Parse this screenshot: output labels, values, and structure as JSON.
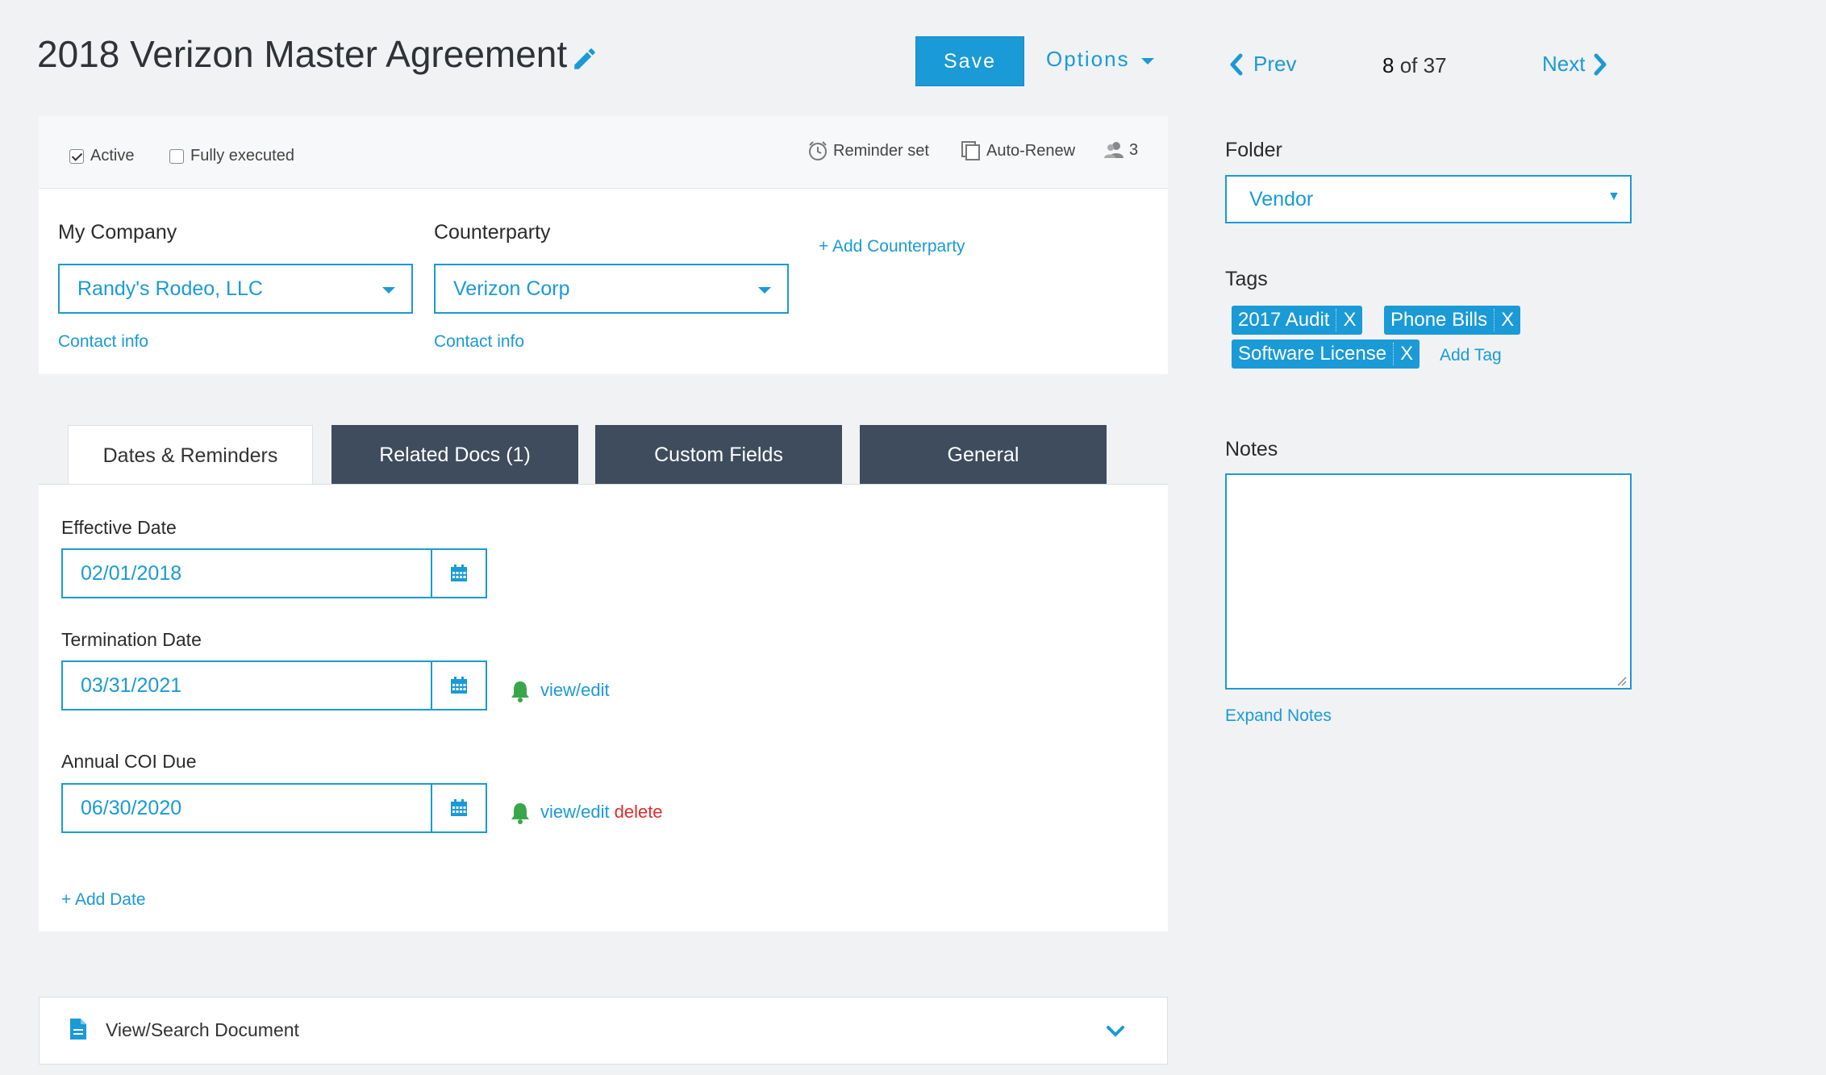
{
  "header": {
    "title": "2018 Verizon Master Agreement",
    "save_label": "Save",
    "options_label": "Options",
    "prev_label": "Prev",
    "page_current": "8",
    "page_of": "of 37",
    "next_label": "Next"
  },
  "status": {
    "active_label": "Active",
    "active_checked": true,
    "fully_executed_label": "Fully executed",
    "fully_executed_checked": false,
    "reminder_label": "Reminder set",
    "auto_renew_label": "Auto-Renew",
    "users_count": "3"
  },
  "parties": {
    "my_company_label": "My Company",
    "my_company_value": "Randy's Rodeo, LLC",
    "my_company_contact": "Contact info",
    "counterparty_label": "Counterparty",
    "counterparty_value": "Verizon Corp",
    "counterparty_contact": "Contact info",
    "add_counterparty": "+ Add Counterparty"
  },
  "tabs": [
    {
      "label": "Dates & Reminders",
      "active": true
    },
    {
      "label": "Related Docs (1)",
      "active": false
    },
    {
      "label": "Custom Fields",
      "active": false
    },
    {
      "label": "General",
      "active": false
    }
  ],
  "dates": [
    {
      "label": "Effective Date",
      "value": "02/01/2018",
      "has_reminder": false
    },
    {
      "label": "Termination Date",
      "value": "03/31/2021",
      "has_reminder": true,
      "view_edit": "view/edit"
    },
    {
      "label": "Annual COI Due",
      "value": "06/30/2020",
      "has_reminder": true,
      "view_edit": "view/edit",
      "delete": "delete"
    }
  ],
  "add_date": "+ Add Date",
  "document": {
    "label": "View/Search Document"
  },
  "sidebar": {
    "folder_label": "Folder",
    "folder_value": "Vendor",
    "tags_label": "Tags",
    "tags": [
      "2017 Audit",
      "Phone Bills",
      "Software License"
    ],
    "tag_remove": "X",
    "add_tag": "Add Tag",
    "notes_label": "Notes",
    "notes_value": "",
    "expand_notes": "Expand Notes"
  },
  "colors": {
    "accent": "#1a9ad6",
    "tab_dark": "#3e4c5e",
    "bell_green": "#3aa64a",
    "delete_red": "#e02b2b"
  }
}
